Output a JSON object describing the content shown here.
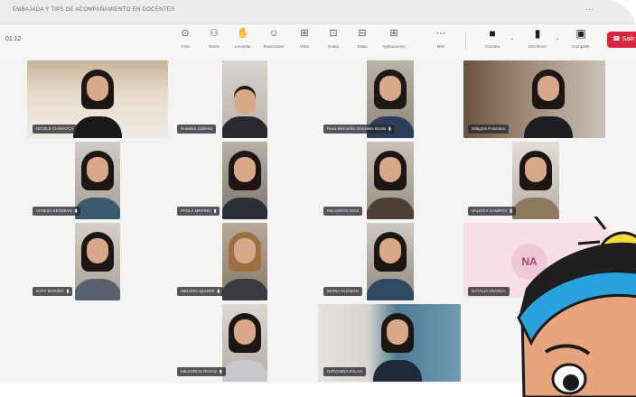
{
  "window": {
    "title": "EMBAJADA Y TIPS DE ACOMPAÑAMIENTO EN DOCENTES"
  },
  "toolbar": {
    "timer": "01:12",
    "buttons": [
      {
        "id": "chat",
        "icon": "chat-icon",
        "glyph": "⊙",
        "label": "Chat"
      },
      {
        "id": "people",
        "icon": "people-icon",
        "glyph": "⚇",
        "label": "Gente"
      },
      {
        "id": "raise",
        "icon": "hand-icon",
        "glyph": "✋",
        "label": "Levantar"
      },
      {
        "id": "react",
        "icon": "smile-icon",
        "glyph": "☺",
        "label": "Reaccionar"
      },
      {
        "id": "view",
        "icon": "grid-icon",
        "glyph": "⊞",
        "label": "Vista"
      },
      {
        "id": "rooms",
        "icon": "rooms-icon",
        "glyph": "⊡",
        "label": "Notas"
      },
      {
        "id": "notes",
        "icon": "notes-icon",
        "glyph": "⊟",
        "label": "Salas"
      },
      {
        "id": "apps",
        "icon": "apps-icon",
        "glyph": "⊞",
        "label": "Aplicaciones"
      },
      {
        "id": "more",
        "icon": "more-icon",
        "glyph": "⋯",
        "label": "Más"
      }
    ],
    "media": [
      {
        "id": "camera",
        "icon": "camera-icon",
        "glyph": "■",
        "label": "Cámara"
      },
      {
        "id": "mic",
        "icon": "microphone-icon",
        "glyph": "▮",
        "label": "Micrófono"
      },
      {
        "id": "share",
        "icon": "share-icon",
        "glyph": "▣",
        "label": "Compartir"
      }
    ],
    "leave_label": "Salir"
  },
  "participants": [
    {
      "name": "NICOLE CHIMAYCA",
      "muted": false
    },
    {
      "name": "Rosalina Cabrera",
      "muted": false
    },
    {
      "name": "Rosa Mercedes Gonzales Borda",
      "muted": true
    },
    {
      "name": "Milagros Palomino",
      "muted": false
    },
    {
      "name": "VANEZA ESTEBAN",
      "muted": true
    },
    {
      "name": "PAOLA MERINO",
      "muted": true
    },
    {
      "name": "MILAGROS DIAZ",
      "muted": false
    },
    {
      "name": "VALERIA CAMPOS",
      "muted": true
    },
    {
      "name": "KATY MARIÑO",
      "muted": true
    },
    {
      "name": "MELISSA QUISPE",
      "muted": true
    },
    {
      "name": "MARIA HUAMAN",
      "muted": false
    },
    {
      "name": "NATALIA ARANDA",
      "muted": false
    },
    {
      "name": "MILAGROS ROJAS",
      "muted": true
    },
    {
      "name": "GIOVANNA SALAS",
      "muted": false
    }
  ],
  "avatar_tile": {
    "initials": "NA"
  }
}
